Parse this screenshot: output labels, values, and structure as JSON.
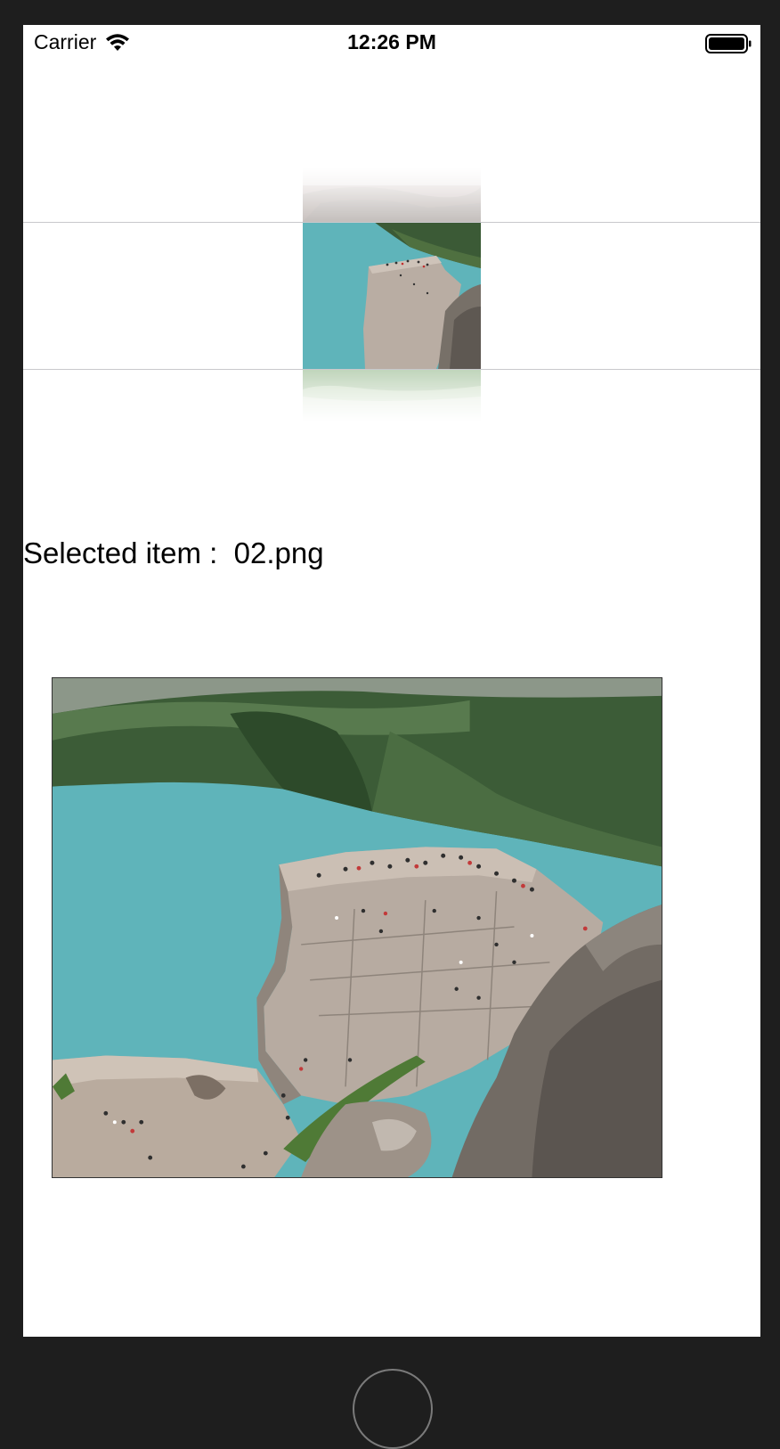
{
  "status_bar": {
    "carrier": "Carrier",
    "time": "12:26 PM",
    "icons": [
      "wifi-icon",
      "battery-icon"
    ]
  },
  "picker": {
    "items": [
      {
        "name": "01.png",
        "state": "previous"
      },
      {
        "name": "02.png",
        "state": "selected"
      },
      {
        "name": "03.png",
        "state": "next"
      }
    ]
  },
  "selection": {
    "label": "Selected item :  02.png"
  },
  "colors": {
    "background": "#1e1e1e",
    "screen": "#ffffff",
    "separator": "#c8c8cc",
    "fjord_water": "#5fb4ba"
  }
}
